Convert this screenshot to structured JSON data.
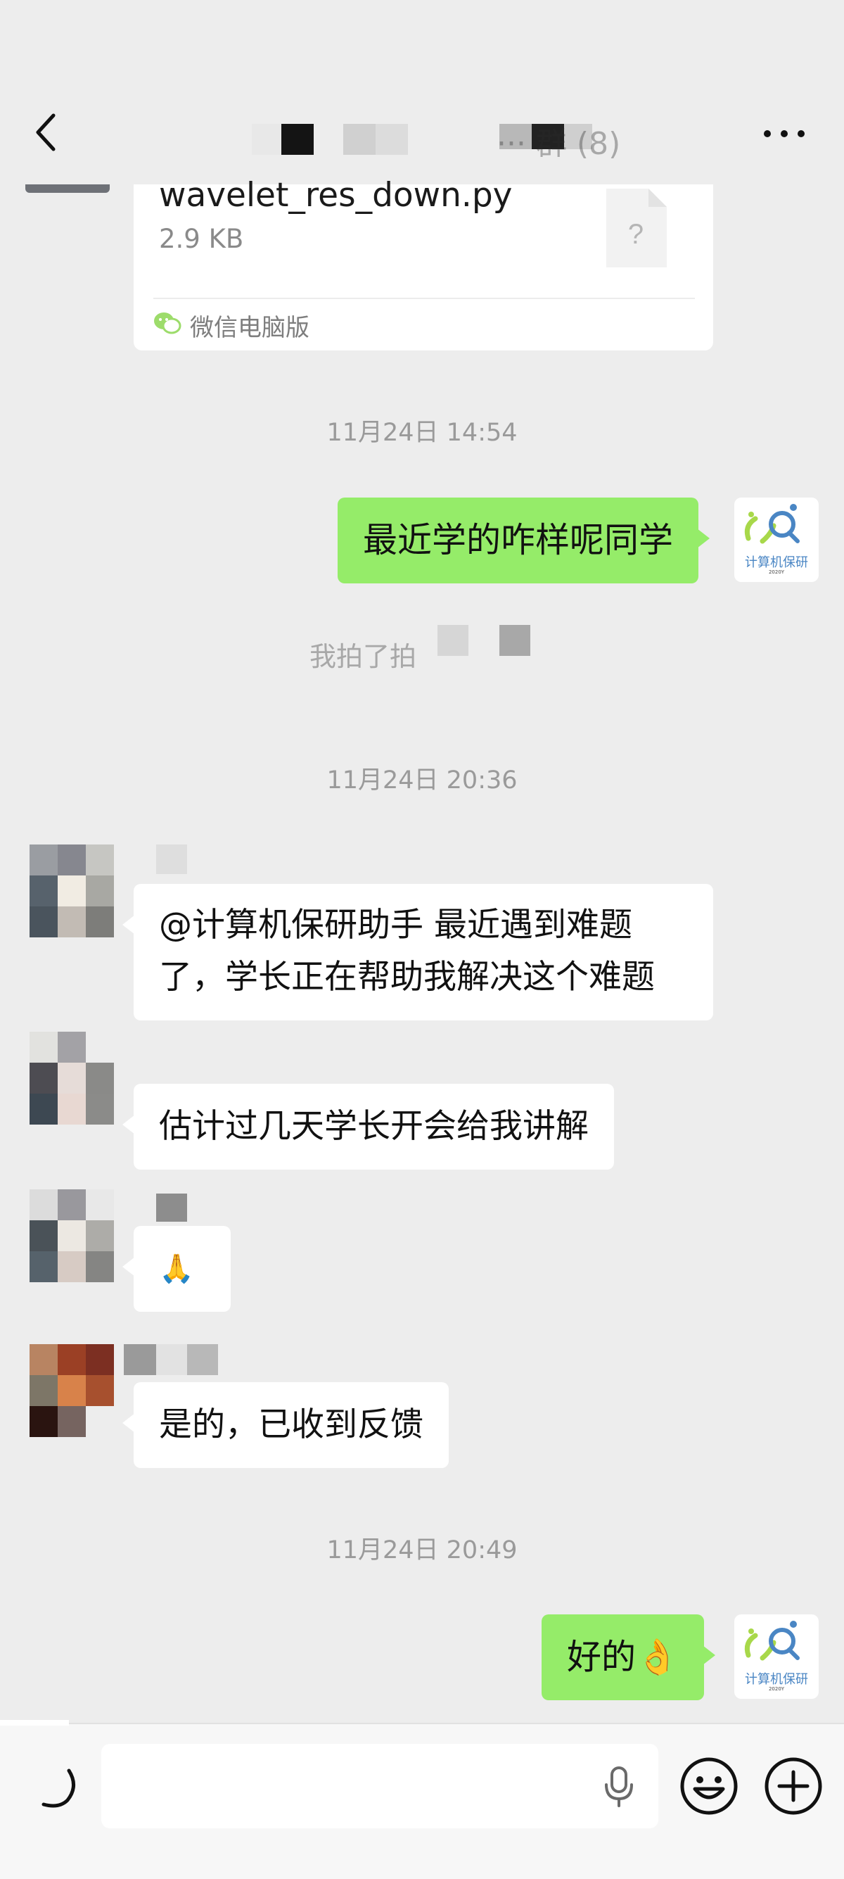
{
  "header": {
    "title": "··· 群 (8)",
    "more_label": "···"
  },
  "file_message": {
    "file_name": "wavelet_res_down.py",
    "file_size": "2.9 KB",
    "file_icon_glyph": "?",
    "source": "微信电脑版"
  },
  "messages": {
    "ts1": "11月24日 14:54",
    "m1": "最近学的咋样呢同学",
    "system_pat": "我拍了拍",
    "ts2": "11月24日 20:36",
    "m2_line1": "@计算机保研助手  最近遇到难题",
    "m2_line2": "了，学长正在帮助我解决这个难题",
    "m3": "估计过几天学长开会给我讲解",
    "m4": "🙏",
    "m5": "是的，已收到反馈",
    "ts3": "11月24日 20:49",
    "m6": "好的👌"
  },
  "my_avatar": {
    "label": "计算机保研",
    "sub": "2020Y"
  },
  "input": {
    "placeholder": ""
  },
  "colors": {
    "background": "#ededed",
    "my_bubble": "#95ec69",
    "other_bubble": "#ffffff",
    "accent_blue": "#4a86c4"
  },
  "icons": {
    "back": "chevron-left-icon",
    "more": "more-dots-icon",
    "file": "unknown-file-icon",
    "voice": "voice-icon",
    "mic": "mic-icon",
    "emoji": "emoji-icon",
    "plus": "plus-icon"
  }
}
